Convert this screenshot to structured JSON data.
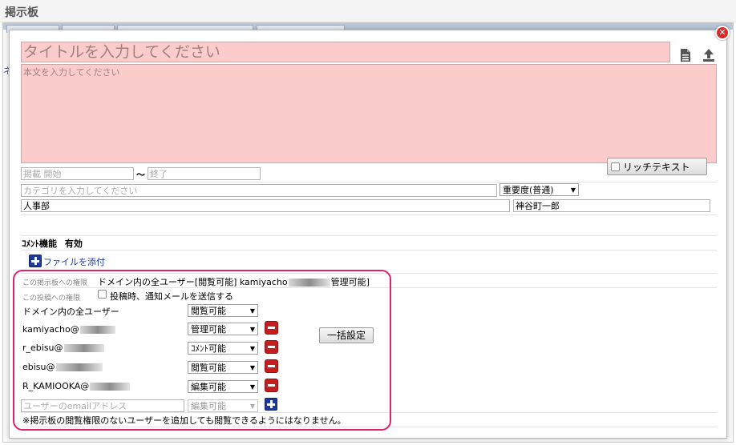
{
  "page": {
    "title": "掲示板",
    "background_link": "ネ"
  },
  "dialog": {
    "close_label": "✕",
    "title_placeholder": "タイトルを入力してください",
    "body_placeholder": "本文を入力してください",
    "rich_text_label": "リッチテキスト",
    "start_placeholder": "掲載 開始",
    "range_separator": "〜",
    "end_placeholder": "終了",
    "category_placeholder": "カテゴリを入力してください",
    "importance_value": "重要度(普通)",
    "department_value": "人事部",
    "author_value": "神谷町一郎",
    "comment_feature_label": "ｺﾒﾝﾄ機能",
    "comment_feature_value": "有効",
    "attach_file_label": "ファイルを添付",
    "board_permission_label": "この掲示板への権限",
    "board_permission_value_1": "ドメイン内の全ユーザー[閲覧可能]",
    "board_permission_value_2": "kamiyacho",
    "board_permission_value_3": "管理可能]",
    "post_permission_label": "この投稿への権限",
    "notify_label": "投稿時、通知メールを送信する",
    "bulk_button_label": "一括設定",
    "new_user_placeholder": "ユーザーのemailアドレス",
    "new_user_permission": "編集可能",
    "footer_note": "※掲示板の閲覧権限のないユーザーを追加しても閲覧できるようにはなりません。",
    "permissions": [
      {
        "user": "ドメイン内の全ユーザー",
        "permission": "閲覧可能"
      },
      {
        "user": "kamiyacho@",
        "permission": "管理可能"
      },
      {
        "user": "r_ebisu@",
        "permission": "ｺﾒﾝﾄ可能"
      },
      {
        "user": "ebisu@",
        "permission": "閲覧可能"
      },
      {
        "user": "R_KAMIOOKA@",
        "permission": "編集可能"
      }
    ]
  },
  "colors": {
    "title_bg": "#fccccc",
    "highlight": "#e0206e",
    "remove": "#c41e1e",
    "add": "#1d3a9a"
  },
  "icons": [
    "close-icon",
    "document-icon",
    "upload-icon",
    "add-file-icon",
    "remove-icon",
    "add-icon",
    "chevron-down-icon"
  ]
}
